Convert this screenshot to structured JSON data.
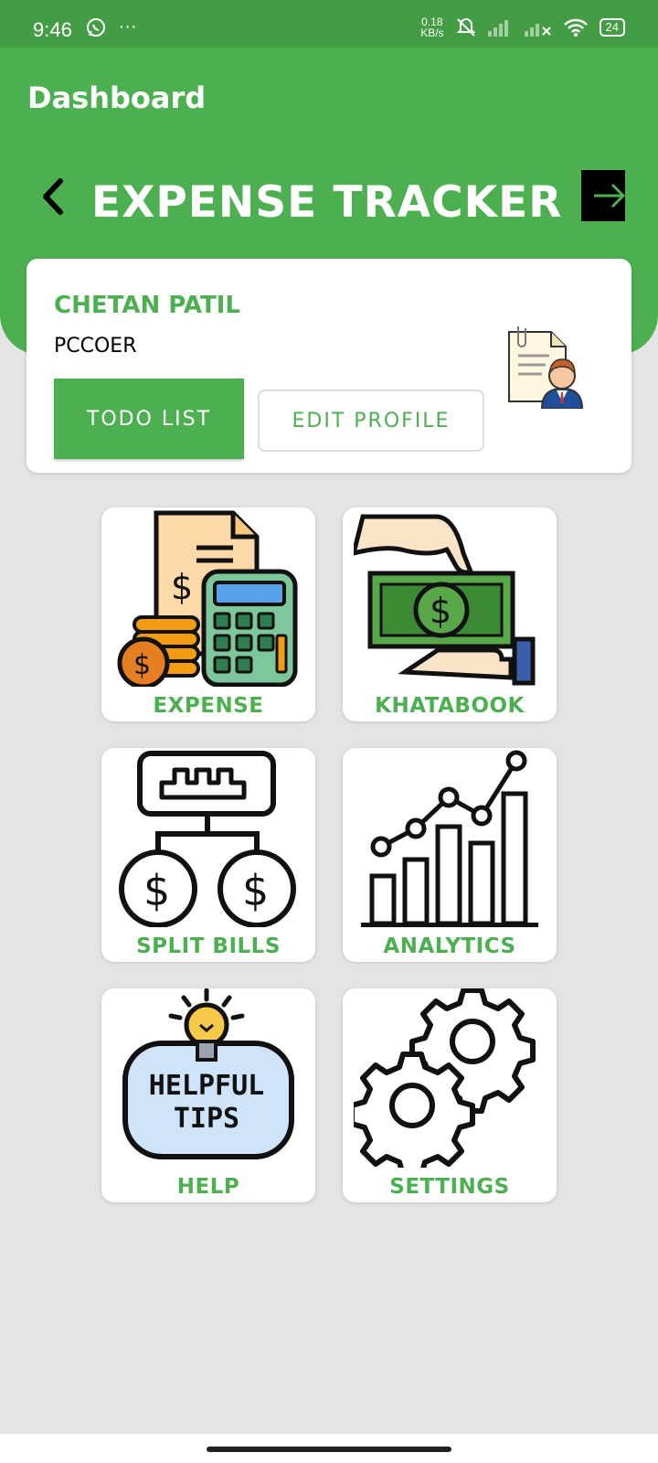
{
  "status_bar": {
    "time": "9:46",
    "left_icons": [
      "whatsapp-icon",
      "more-icon"
    ],
    "net_speed_value": "0.18",
    "net_speed_unit": "KB/s",
    "battery": "24",
    "right_icons": [
      "mute-icon",
      "signal-icon",
      "signal-icon",
      "wifi-icon",
      "battery-icon"
    ]
  },
  "app_bar": {
    "title": "Dashboard"
  },
  "header": {
    "title": "EXPENSE TRACKER",
    "back_icon": "chevron-left-icon",
    "logout_icon": "logout-icon"
  },
  "profile": {
    "name": "CHETAN PATIL",
    "org": "PCCOER",
    "todo_label": "TODO LIST",
    "edit_label": "EDIT PROFILE",
    "avatar_icon": "profile-document-icon"
  },
  "tiles": [
    {
      "label": "EXPENSE",
      "icon": "expense-calculator-icon"
    },
    {
      "label": "KHATABOOK",
      "icon": "money-exchange-icon"
    },
    {
      "label": "SPLIT BILLS",
      "icon": "split-bills-icon"
    },
    {
      "label": "ANALYTICS",
      "icon": "analytics-chart-icon"
    },
    {
      "label": "HELP",
      "icon": "helpful-tips-icon",
      "icon_text_1": "HELPFUL",
      "icon_text_2": "TIPS"
    },
    {
      "label": "SETTINGS",
      "icon": "settings-gears-icon"
    }
  ],
  "colors": {
    "primary": "#4caf50",
    "status_bar": "#449d44",
    "background": "#e4e4e4"
  }
}
